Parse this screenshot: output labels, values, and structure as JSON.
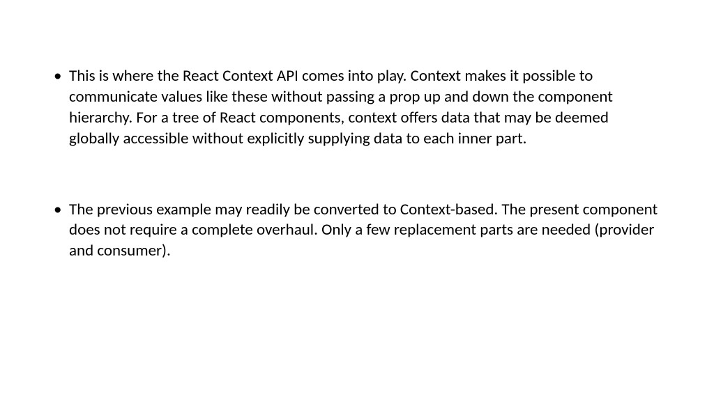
{
  "bullets": [
    "This is where the React Context API comes into play. Context makes it possible to communicate values like these without passing a prop up and down the component hierarchy. For a tree of React components, context offers data that may be deemed globally accessible without explicitly supplying data to each inner part.",
    "The previous example may readily be converted to Context-based. The present component does not require a complete overhaul. Only a few replacement parts are needed (provider and consumer)."
  ]
}
